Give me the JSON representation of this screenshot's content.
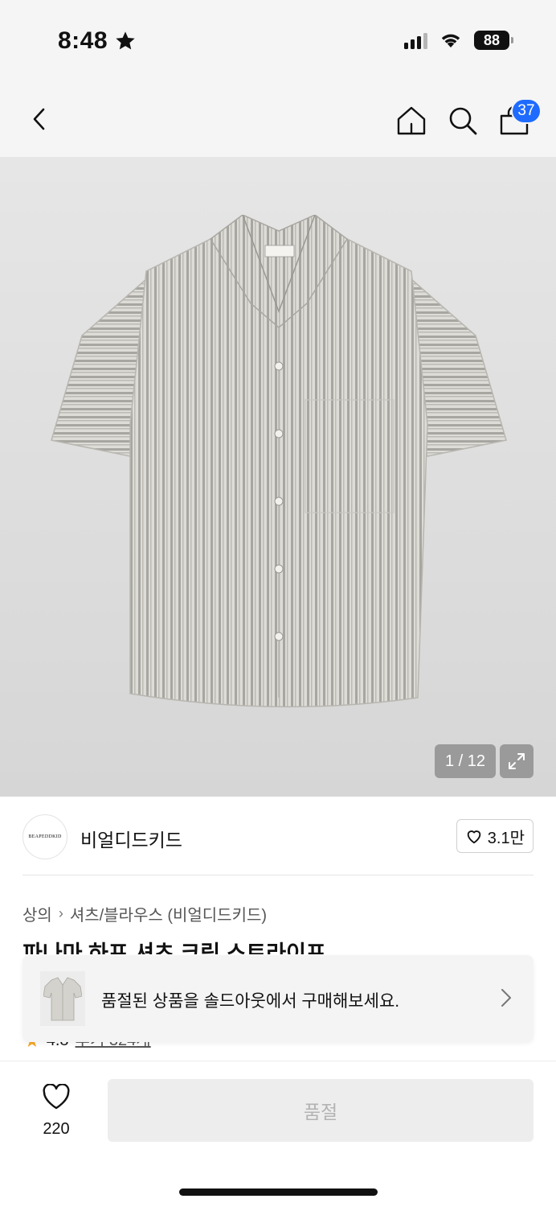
{
  "status_bar": {
    "time": "8:48",
    "battery": "88"
  },
  "nav": {
    "cart_count": "37"
  },
  "gallery": {
    "counter": "1 / 12"
  },
  "brand": {
    "logo_text": "BEAPEDDKID",
    "name": "비얼디드키드",
    "likes": "3.1만"
  },
  "breadcrumb": {
    "category": "상의",
    "subcategory": "셔츠/블라우스 (비얼디드키드)"
  },
  "product": {
    "title": "파나마 하프 셔츠 크림 스트라이프",
    "rating": "4.8",
    "review_link": "후기 324개"
  },
  "toast": {
    "message": "품절된 상품을 솔드아웃에서 구매해보세요."
  },
  "bottom": {
    "wish_count": "220",
    "soldout_label": "품절"
  },
  "colors": {
    "badge": "#1f6bff",
    "star": "#f5a623",
    "disabled_button": "#ededed"
  }
}
